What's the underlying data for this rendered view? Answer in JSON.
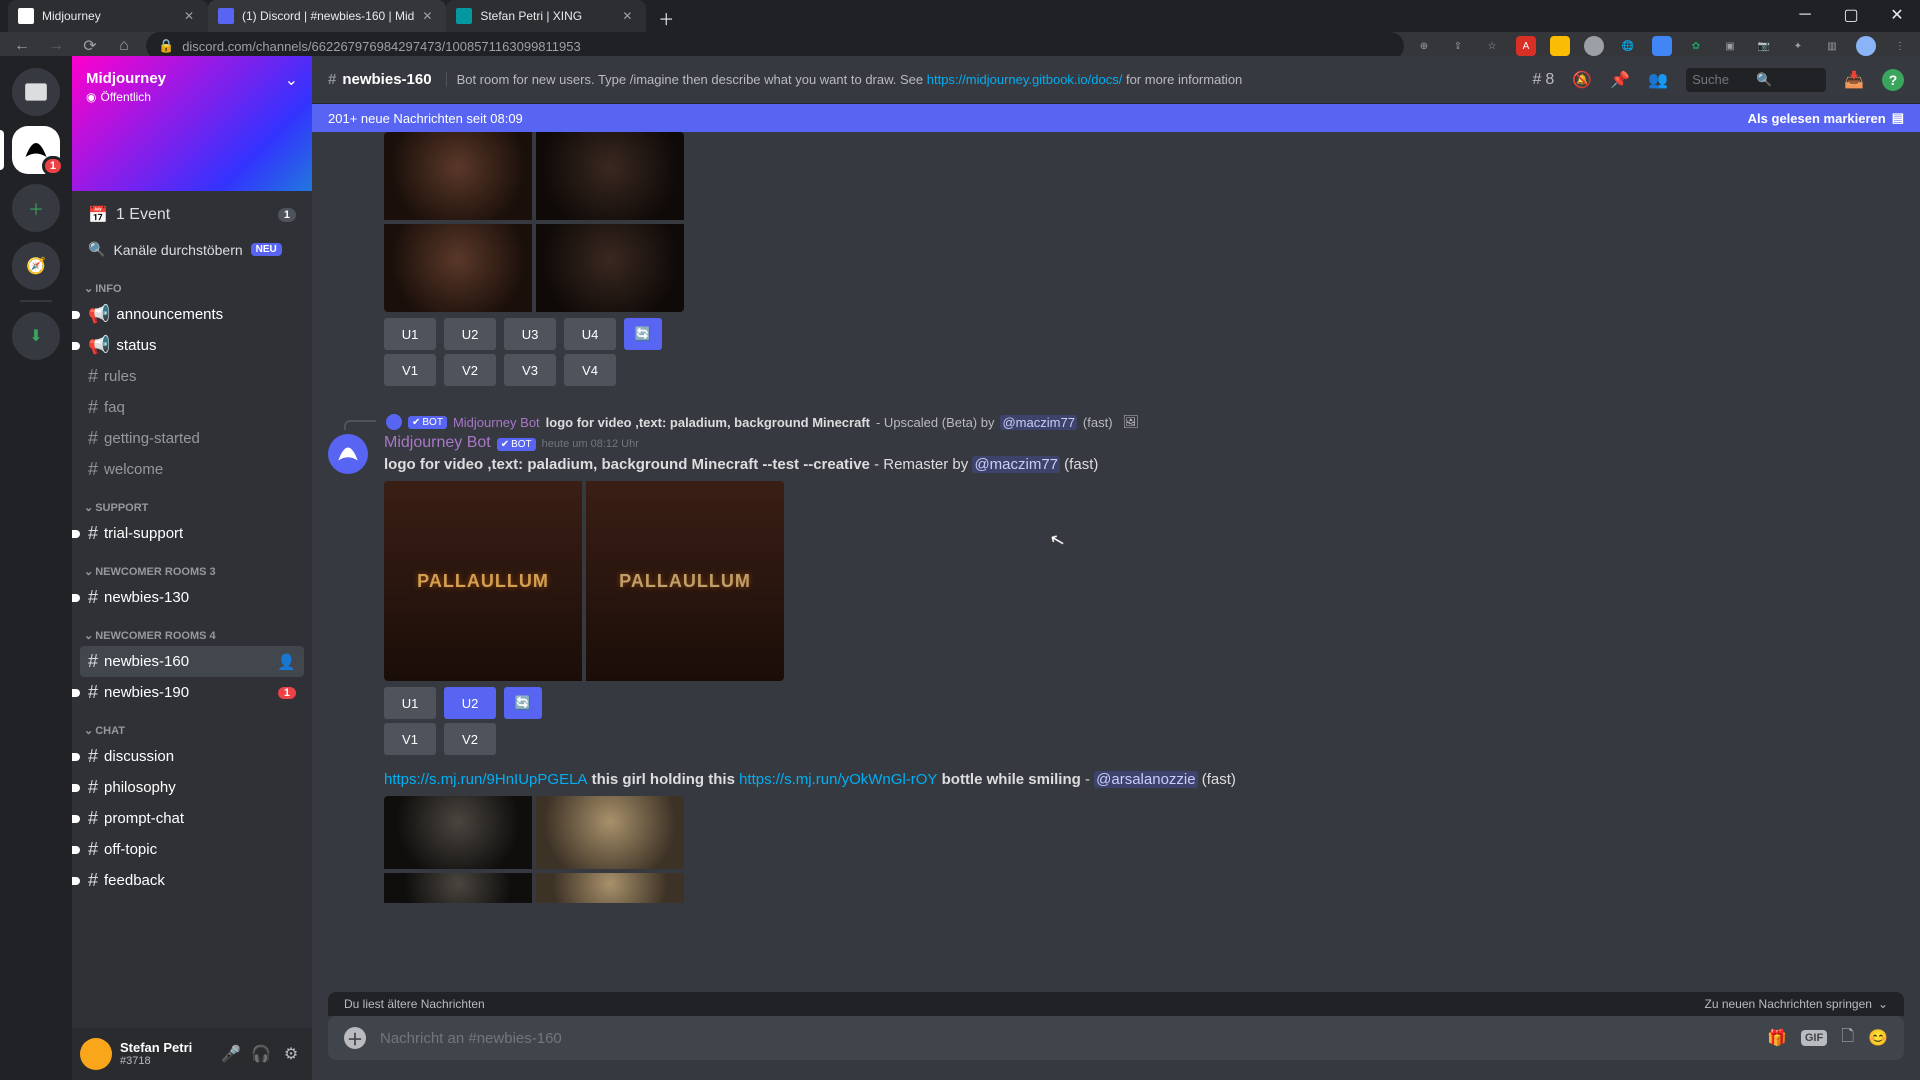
{
  "tabs": [
    {
      "title": "Midjourney"
    },
    {
      "title": "(1) Discord | #newbies-160 | Mid"
    },
    {
      "title": "Stefan Petri | XING"
    }
  ],
  "url": "discord.com/channels/662267976984297473/1008571163099811953",
  "server": {
    "name": "Midjourney",
    "visibility": "Öffentlich"
  },
  "event": {
    "label": "1 Event",
    "count": "1"
  },
  "browse_label": "Kanäle durchstöbern",
  "neu": "NEU",
  "cats": {
    "info": "INFO",
    "support": "SUPPORT",
    "nr3": "NEWCOMER ROOMS 3",
    "nr4": "NEWCOMER ROOMS 4",
    "chat": "CHAT"
  },
  "channels": {
    "announcements": "announcements",
    "status": "status",
    "rules": "rules",
    "faq": "faq",
    "getting": "getting-started",
    "welcome": "welcome",
    "trial": "trial-support",
    "n130": "newbies-130",
    "n160": "newbies-160",
    "n190": "newbies-190",
    "discussion": "discussion",
    "philosophy": "philosophy",
    "prompt": "prompt-chat",
    "offtopic": "off-topic",
    "feedback": "feedback"
  },
  "n190_badge": "1",
  "user": {
    "name": "Stefan Petri",
    "disc": "#3718"
  },
  "header": {
    "channel": "newbies-160",
    "topic_pre": "Bot room for new users. Type /imagine then describe what you want to draw. See ",
    "topic_link": "https://midjourney.gitbook.io/docs/",
    "topic_post": " for more information",
    "thread_count": "8",
    "search": "Suche"
  },
  "newbar": {
    "text": "201+ neue Nachrichten seit 08:09",
    "mark": "Als gelesen markieren"
  },
  "msg1": {
    "u1": "U1",
    "u2": "U2",
    "u3": "U3",
    "u4": "U4",
    "v1": "V1",
    "v2": "V2",
    "v3": "V3",
    "v4": "V4"
  },
  "msg2": {
    "reply_bot": "Midjourney Bot",
    "reply_tag": "BOT",
    "reply_prompt": "logo for video ,text: paladium, background Minecraft",
    "reply_suffix": " - Upscaled (Beta) by ",
    "reply_user": "@maczim77",
    "reply_fast": " (fast)",
    "author": "Midjourney Bot",
    "tag": "BOT",
    "time": "heute um 08:12 Uhr",
    "prompt": "logo for video ,text: paladium, background Minecraft --test --creative",
    "suffix": " - Remaster by ",
    "user": "@maczim77",
    "fast": " (fast)",
    "pallad": "PALLAULLUM",
    "u1": "U1",
    "u2": "U2",
    "v1": "V1",
    "v2": "V2"
  },
  "msg3": {
    "link1": "https://s.mj.run/9HnIUpPGELA",
    "mid1": " this girl holding this ",
    "link2": "https://s.mj.run/yOkWnGl-rOY",
    "mid2": " bottle while smiling",
    "dash": " - ",
    "user": "@arsalanozzie",
    "fast": " (fast)"
  },
  "oldbar": {
    "text": "Du liest ältere Nachrichten",
    "jump": "Zu neuen Nachrichten springen"
  },
  "input": {
    "placeholder": "Nachricht an #newbies-160",
    "gif": "GIF"
  }
}
